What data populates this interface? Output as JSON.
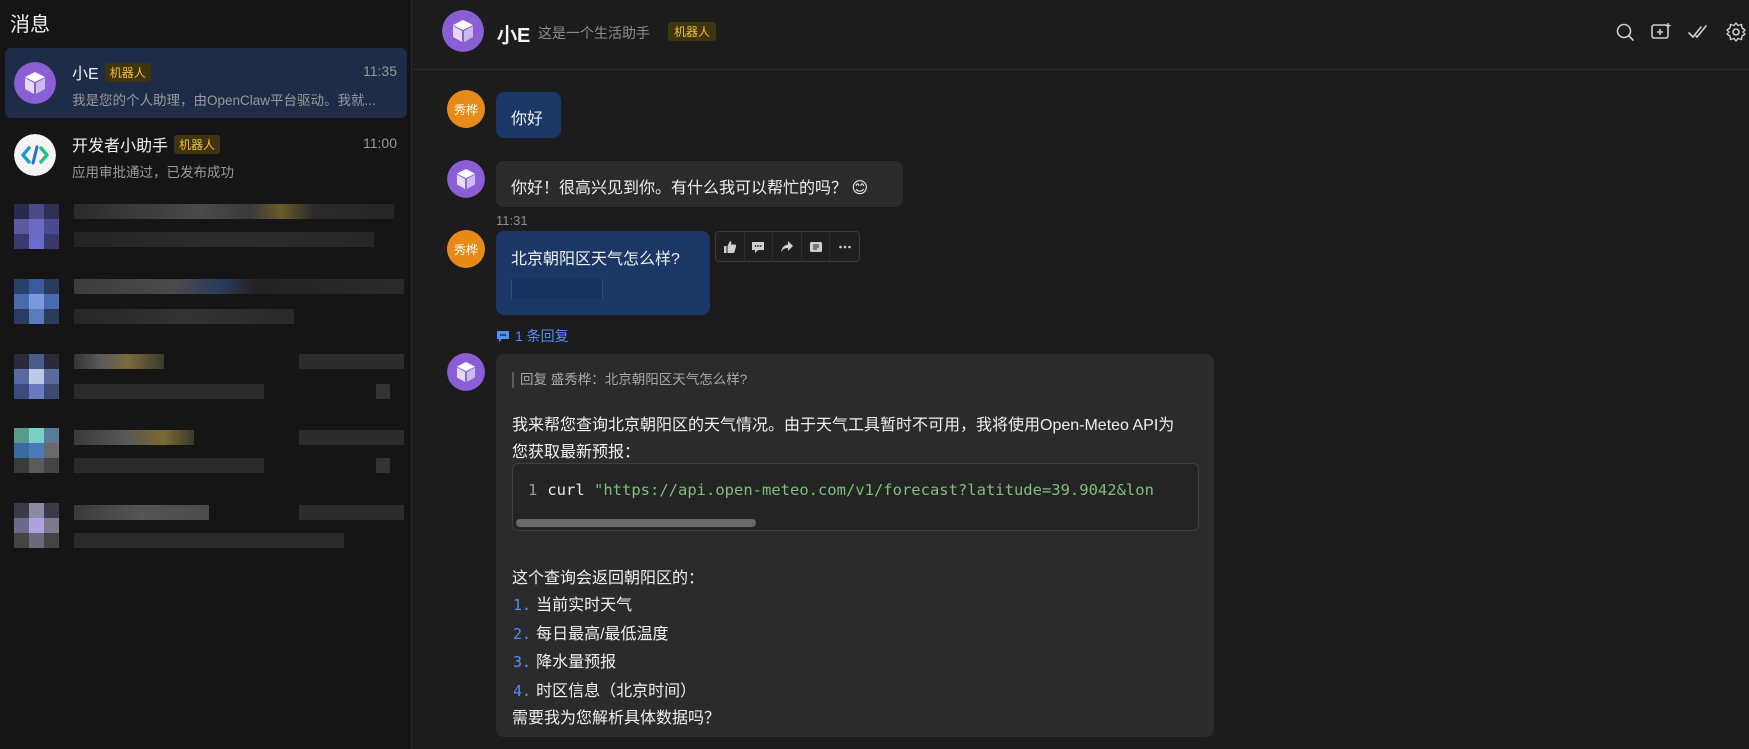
{
  "sidebar": {
    "title": "消息",
    "conversations": [
      {
        "name": "小E",
        "tag": "机器人",
        "time": "11:35",
        "preview": "我是您的个人助理，由OpenClaw平台驱动。我就..."
      },
      {
        "name": "开发者小助手",
        "tag": "机器人",
        "time": "11:00",
        "preview": "应用审批通过，已发布成功"
      }
    ]
  },
  "header": {
    "name": "小E",
    "subtitle": "这是一个生活助手",
    "tag": "机器人",
    "icons": [
      "search-icon",
      "add-chat-icon",
      "mark-read-icon",
      "settings-icon"
    ]
  },
  "messages": {
    "user_avatar": "秀桦",
    "m1": {
      "text": "你好"
    },
    "m2": {
      "text": "你好！很高兴见到你。有什么我可以帮忙的吗？",
      "emoji": "😊"
    },
    "m3": {
      "time": "11:31",
      "text": "北京朝阳区天气怎么样?",
      "reply_count": "1 条回复"
    },
    "m4": {
      "quote": "回复 盛秀桦：北京朝阳区天气怎么样?",
      "intro_line1": "我来帮您查询北京朝阳区的天气情况。由于天气工具暂时不可用，我将使用Open-Meteo API为",
      "intro_line2": "您获取最新预报：",
      "code_line_no": "1",
      "code_cmd": "curl",
      "code_str": "\"https://api.open-meteo.com/v1/forecast?latitude=39.9042&lon",
      "list_intro": "这个查询会返回朝阳区的：",
      "items": [
        {
          "num": "1.",
          "text": "当前实时天气"
        },
        {
          "num": "2.",
          "text": "每日最高/最低温度"
        },
        {
          "num": "3.",
          "text": "降水量预报"
        },
        {
          "num": "4.",
          "text": "时区信息（北京时间）"
        }
      ],
      "outro": "需要我为您解析具体数据吗？"
    }
  },
  "colors": {
    "accent": "#4f8ff7",
    "user_bubble": "#1a3766",
    "bot_bubble": "#2b2b2b",
    "bot_tag": "#f0c040",
    "user_avatar": "#e88a17"
  }
}
